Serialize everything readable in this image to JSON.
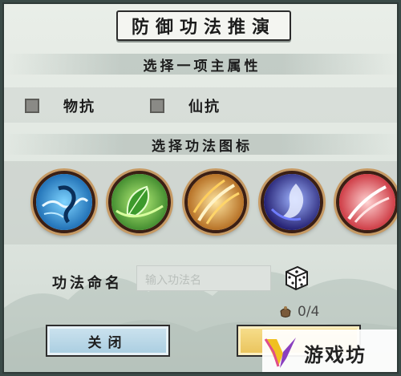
{
  "title": "防御功法推演",
  "attribute_section": {
    "header": "选择一项主属性",
    "options": [
      {
        "label": "物抗",
        "checked": false
      },
      {
        "label": "仙抗",
        "checked": false
      }
    ]
  },
  "icon_section": {
    "header": "选择功法图标",
    "icons": [
      {
        "name": "water-dragon-icon",
        "color": "#1e8fd6"
      },
      {
        "name": "leaf-icon",
        "color": "#3fa63a"
      },
      {
        "name": "golden-slash-icon",
        "color": "#e59a1f"
      },
      {
        "name": "blue-flame-icon",
        "color": "#3b3ad0"
      },
      {
        "name": "red-wing-icon",
        "color": "#e24a4a"
      }
    ]
  },
  "naming": {
    "label": "功法命名",
    "placeholder": "输入功法名",
    "random_icon": "dice-icon"
  },
  "cost": {
    "icon": "pot-icon",
    "text": "0/4"
  },
  "buttons": {
    "close": "关闭",
    "confirm": ""
  },
  "watermark": {
    "text": "游戏坊"
  }
}
